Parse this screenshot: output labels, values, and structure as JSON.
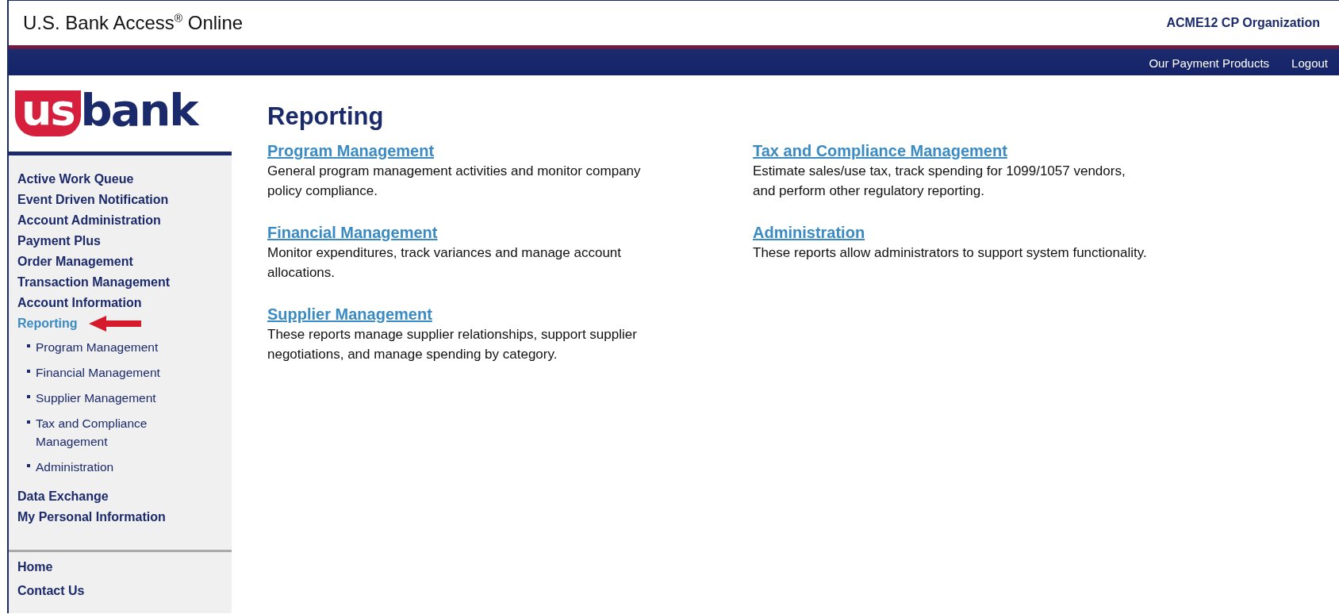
{
  "header": {
    "title": "U.S. Bank Access$^{®}$ Online",
    "organization": "ACME12 CP Organization",
    "nav_links": [
      "Our Payment Products",
      "Logout"
    ]
  },
  "logo": {
    "mark": "us",
    "word": "bank"
  },
  "sidebar": {
    "items": [
      {
        "label": "Active Work Queue",
        "selected": false
      },
      {
        "label": "Event Driven Notification",
        "selected": false
      },
      {
        "label": "Account Administration",
        "selected": false
      },
      {
        "label": "Payment Plus",
        "selected": false
      },
      {
        "label": "Order Management",
        "selected": false
      },
      {
        "label": "Transaction Management",
        "selected": false
      },
      {
        "label": "Account Information",
        "selected": false
      },
      {
        "label": "Reporting",
        "selected": true,
        "arrow": true,
        "children": [
          {
            "label": "Program Management",
            "selected": false
          },
          {
            "label": "Financial Management",
            "selected": false
          },
          {
            "label": "Supplier Management",
            "selected": false
          },
          {
            "label": "Tax and Compliance Management",
            "selected": false
          },
          {
            "label": "Administration",
            "selected": false
          }
        ]
      },
      {
        "label": "Data Exchange",
        "selected": false
      },
      {
        "label": "My Personal Information",
        "selected": false
      }
    ],
    "footer_items": [
      "Home",
      "Contact Us"
    ]
  },
  "content": {
    "heading": "Reporting",
    "columns": [
      [
        {
          "title": "Program Management",
          "description": "General program management activities and monitor company policy compliance."
        },
        {
          "title": "Financial Management",
          "description": "Monitor expenditures, track variances and manage account allocations."
        },
        {
          "title": "Supplier Management",
          "description": "These reports manage supplier relationships, support supplier negotiations, and manage spending by category."
        }
      ],
      [
        {
          "title": "Tax and Compliance Management",
          "description": "Estimate sales/use tax, track spending for 1099/1057 vendors, and perform other regulatory reporting."
        },
        {
          "title": "Administration",
          "description": "These reports allow administrators to support system functionality."
        }
      ]
    ]
  }
}
